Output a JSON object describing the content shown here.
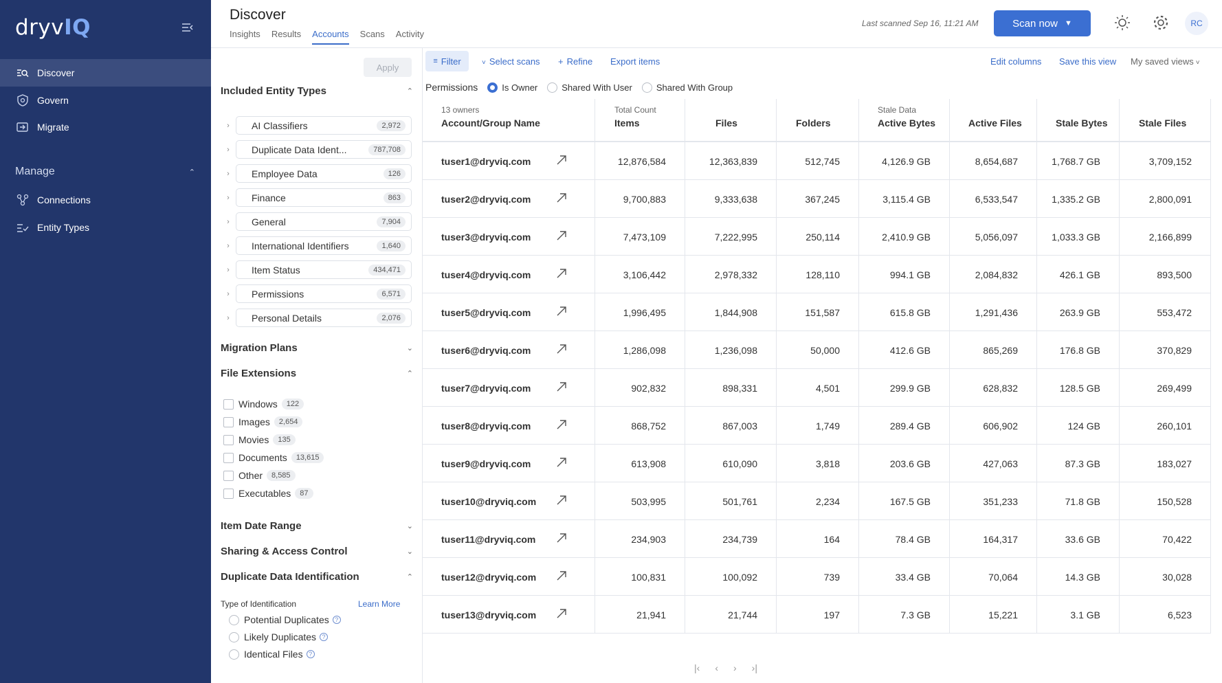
{
  "sidebar": {
    "logo_left": "dryv",
    "logo_right": "IQ",
    "items": [
      {
        "label": "Discover"
      },
      {
        "label": "Govern"
      },
      {
        "label": "Migrate"
      }
    ],
    "manage_section": "Manage",
    "manage_items": [
      {
        "label": "Connections"
      },
      {
        "label": "Entity Types"
      }
    ]
  },
  "header": {
    "title": "Discover",
    "tabs": [
      {
        "label": "Insights"
      },
      {
        "label": "Results"
      },
      {
        "label": "Accounts"
      },
      {
        "label": "Scans"
      },
      {
        "label": "Activity"
      }
    ],
    "last_scanned": "Last scanned Sep 16, 11:21 AM",
    "scan_button": "Scan now",
    "avatar": "RC"
  },
  "filters": {
    "apply": "Apply",
    "included_entity_types": "Included Entity Types",
    "entity_types": [
      {
        "label": "AI Classifiers",
        "count": "2,972"
      },
      {
        "label": "Duplicate Data Ident...",
        "count": "787,708"
      },
      {
        "label": "Employee Data",
        "count": "126"
      },
      {
        "label": "Finance",
        "count": "863"
      },
      {
        "label": "General",
        "count": "7,904"
      },
      {
        "label": "International Identifiers",
        "count": "1,640"
      },
      {
        "label": "Item Status",
        "count": "434,471"
      },
      {
        "label": "Permissions",
        "count": "6,571"
      },
      {
        "label": "Personal Details",
        "count": "2,076"
      }
    ],
    "migration_plans": "Migration Plans",
    "file_extensions": "File Extensions",
    "extensions": [
      {
        "label": "Windows",
        "count": "122"
      },
      {
        "label": "Images",
        "count": "2,654"
      },
      {
        "label": "Movies",
        "count": "135"
      },
      {
        "label": "Documents",
        "count": "13,615"
      },
      {
        "label": "Other",
        "count": "8,585"
      },
      {
        "label": "Executables",
        "count": "87"
      }
    ],
    "item_date_range": "Item Date Range",
    "sharing_access": "Sharing & Access Control",
    "duplicate_data": "Duplicate Data Identification",
    "type_of_identification": "Type of Identification",
    "learn_more": "Learn More",
    "identification_options": [
      {
        "label": "Potential Duplicates"
      },
      {
        "label": "Likely Duplicates"
      },
      {
        "label": "Identical Files"
      }
    ]
  },
  "toolbar": {
    "filter": "Filter",
    "select_scans": "Select scans",
    "refine": "Refine",
    "export_items": "Export items",
    "edit_columns": "Edit columns",
    "save_view": "Save this view",
    "saved_views": "My saved views"
  },
  "permissions": {
    "label": "Permissions",
    "options": [
      {
        "label": "Is Owner",
        "selected": true
      },
      {
        "label": "Shared With User",
        "selected": false
      },
      {
        "label": "Shared With Group",
        "selected": false
      }
    ]
  },
  "table": {
    "owner_count": "13 owners",
    "group_total": "Total Count",
    "group_stale": "Stale Data",
    "columns": [
      "Account/Group Name",
      "Items",
      "Files",
      "Folders",
      "Active Bytes",
      "Active Files",
      "Stale Bytes",
      "Stale Files"
    ],
    "rows": [
      [
        "tuser1@dryviq.com",
        "12,876,584",
        "12,363,839",
        "512,745",
        "4,126.9 GB",
        "8,654,687",
        "1,768.7 GB",
        "3,709,152"
      ],
      [
        "tuser2@dryviq.com",
        "9,700,883",
        "9,333,638",
        "367,245",
        "3,115.4 GB",
        "6,533,547",
        "1,335.2 GB",
        "2,800,091"
      ],
      [
        "tuser3@dryviq.com",
        "7,473,109",
        "7,222,995",
        "250,114",
        "2,410.9 GB",
        "5,056,097",
        "1,033.3 GB",
        "2,166,899"
      ],
      [
        "tuser4@dryviq.com",
        "3,106,442",
        "2,978,332",
        "128,110",
        "994.1 GB",
        "2,084,832",
        "426.1 GB",
        "893,500"
      ],
      [
        "tuser5@dryviq.com",
        "1,996,495",
        "1,844,908",
        "151,587",
        "615.8 GB",
        "1,291,436",
        "263.9 GB",
        "553,472"
      ],
      [
        "tuser6@dryviq.com",
        "1,286,098",
        "1,236,098",
        "50,000",
        "412.6 GB",
        "865,269",
        "176.8 GB",
        "370,829"
      ],
      [
        "tuser7@dryviq.com",
        "902,832",
        "898,331",
        "4,501",
        "299.9 GB",
        "628,832",
        "128.5 GB",
        "269,499"
      ],
      [
        "tuser8@dryviq.com",
        "868,752",
        "867,003",
        "1,749",
        "289.4 GB",
        "606,902",
        "124 GB",
        "260,101"
      ],
      [
        "tuser9@dryviq.com",
        "613,908",
        "610,090",
        "3,818",
        "203.6 GB",
        "427,063",
        "87.3 GB",
        "183,027"
      ],
      [
        "tuser10@dryviq.com",
        "503,995",
        "501,761",
        "2,234",
        "167.5 GB",
        "351,233",
        "71.8 GB",
        "150,528"
      ],
      [
        "tuser11@dryviq.com",
        "234,903",
        "234,739",
        "164",
        "78.4 GB",
        "164,317",
        "33.6 GB",
        "70,422"
      ],
      [
        "tuser12@dryviq.com",
        "100,831",
        "100,092",
        "739",
        "33.4 GB",
        "70,064",
        "14.3 GB",
        "30,028"
      ],
      [
        "tuser13@dryviq.com",
        "21,941",
        "21,744",
        "197",
        "7.3 GB",
        "15,221",
        "3.1 GB",
        "6,523"
      ]
    ]
  },
  "colors": {
    "sidebar_bg": "#22366b",
    "accent": "#3b6fd2"
  }
}
